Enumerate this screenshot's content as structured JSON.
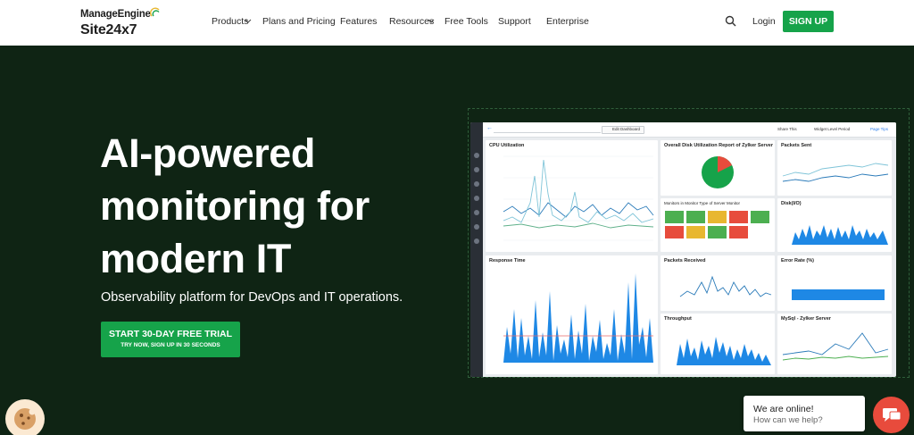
{
  "nav": {
    "logo_top": "ManageEngine",
    "logo_bottom": "Site24x7",
    "items": [
      {
        "label": "Products",
        "dropdown": true
      },
      {
        "label": "Plans and Pricing",
        "dropdown": false
      },
      {
        "label": "Features",
        "dropdown": false
      },
      {
        "label": "Resources",
        "dropdown": true
      },
      {
        "label": "Free Tools",
        "dropdown": false
      },
      {
        "label": "Support",
        "dropdown": false
      },
      {
        "label": "Enterprise",
        "dropdown": false
      }
    ],
    "search_icon": "search-icon",
    "login": "Login",
    "signup": "SIGN UP"
  },
  "hero": {
    "title_line1": "AI-powered",
    "title_line2": "monitoring for",
    "title_line3": "modern IT",
    "subtitle": "Observability platform for DevOps and IT operations.",
    "cta_main": "START 30-DAY FREE TRIAL",
    "cta_small": "TRY NOW, SIGN UP IN 30 SECONDS"
  },
  "dashboard": {
    "edit": "Edit Dashboard",
    "share": "Share This",
    "period": "Widget Level Period",
    "page_tips": "Page Tips",
    "panels": {
      "cpu": "CPU Utilization",
      "disk": "Overall Disk Utilization Report of Zylker Server",
      "packets_sent": "Packets Sent",
      "monitors": "Monitors in Monitor Type of Server Monitor",
      "disk_io": "Disk(I/O)",
      "response": "Response Time",
      "packets_received": "Packets Received",
      "error_rate": "Error Rate (%)",
      "throughput": "Throughput",
      "mysql": "MySql - Zylker Server"
    },
    "monitor_colors": [
      "#4caf50",
      "#4caf50",
      "#e8b730",
      "#e74c3c",
      "#4caf50",
      "#e74c3c",
      "#e8b730",
      "#4caf50",
      "#e74c3c"
    ]
  },
  "chat": {
    "line1": "We are online!",
    "line2": "How can we help?",
    "icon": "chat-icon"
  },
  "cookie_icon": "cookie-icon",
  "colors": {
    "brand_green": "#16a34a",
    "hero_bg": "#0f2414",
    "chat_red": "#e84b3c"
  }
}
